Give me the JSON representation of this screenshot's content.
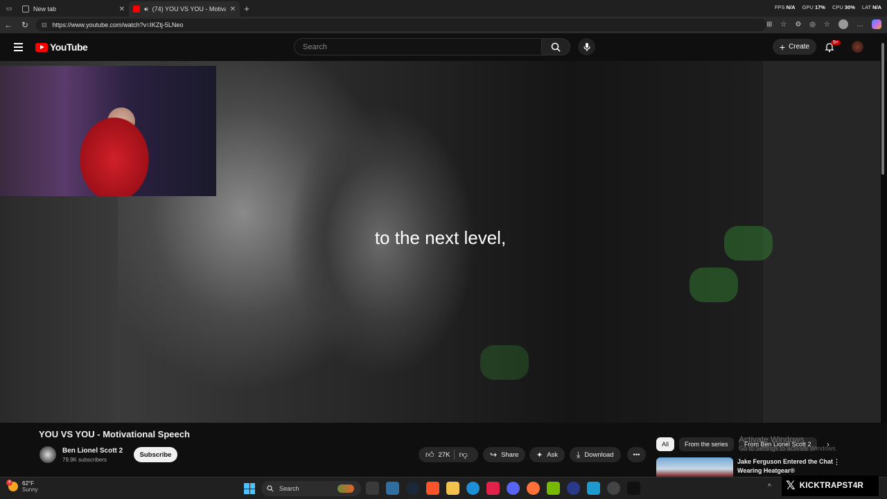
{
  "browser": {
    "tabs": [
      {
        "title": "New tab",
        "active": false
      },
      {
        "title": "(74) YOU VS YOU - Motivatio",
        "active": true
      }
    ],
    "url": "https://www.youtube.com/watch?v=IKZtj-5LNeo",
    "stats": {
      "fps_label": "FPS",
      "fps": "N/A",
      "gpu_label": "GPU",
      "gpu": "17%",
      "cpu_label": "CPU",
      "cpu": "30%",
      "lat_label": "LAT",
      "lat": "N/A"
    }
  },
  "youtube": {
    "logo_text": "YouTube",
    "search_placeholder": "Search",
    "create_label": "Create",
    "notif_badge": "9+"
  },
  "video": {
    "caption": "to the next level,",
    "title": "YOU VS YOU - Motivational Speech",
    "channel": "Ben Lionel Scott 2",
    "subscribers": "79.9K subscribers",
    "subscribe_label": "Subscribe",
    "likes": "27K",
    "share_label": "Share",
    "ask_label": "Ask",
    "download_label": "Download"
  },
  "sidebar": {
    "chips": [
      "All",
      "From the series",
      "From Ben Lionel Scott 2"
    ],
    "watermark_line1": "Activate Windows",
    "watermark_line2": "Go to Settings to activate Windows.",
    "rec_title": "Jake Ferguson Entered the Chat Wearing Heatgear®"
  },
  "taskbar": {
    "temp": "62°F",
    "condition": "Sunny",
    "weather_badge": "4",
    "search_label": "Search"
  },
  "overlay": {
    "handle": "KICKTRAPST4R"
  },
  "colors": {
    "yt_red": "#ff0000",
    "bg": "#0f0f0f",
    "pill": "#272727"
  }
}
